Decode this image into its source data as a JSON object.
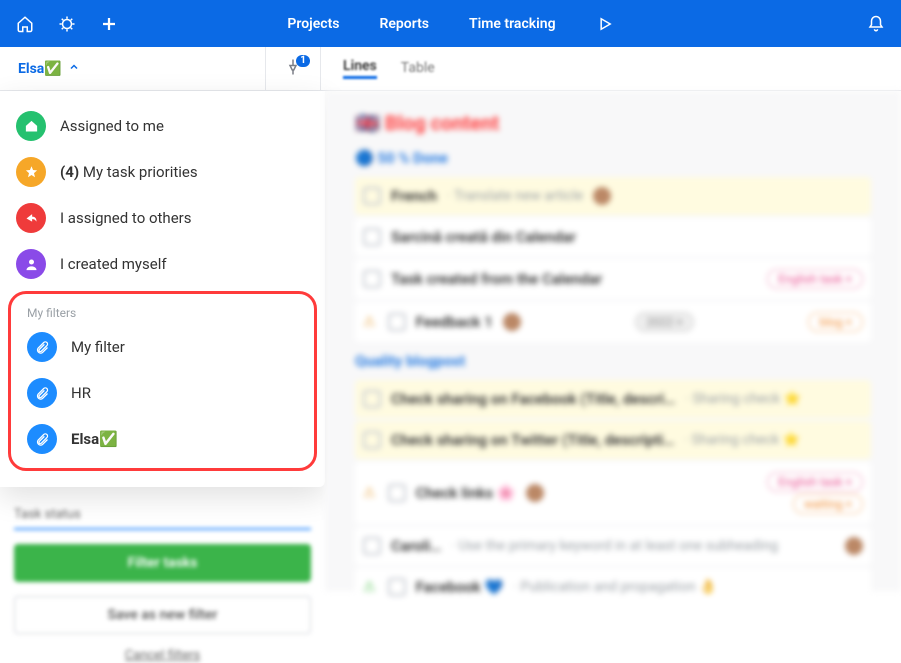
{
  "topbar": {
    "nav": {
      "projects": "Projects",
      "reports": "Reports",
      "time_tracking": "Time tracking"
    }
  },
  "subheader": {
    "filter_name": "Elsa✅",
    "pin_badge": "1",
    "tabs": {
      "lines": "Lines",
      "table": "Table"
    }
  },
  "sidebar": {
    "assigned_to_me": "Assigned to me",
    "priorities_count": "(4)",
    "priorities_label": "My task priorities",
    "assigned_to_others": "I assigned to others",
    "created_myself": "I created myself",
    "my_filters_header": "My filters",
    "filters": {
      "my_filter": "My filter",
      "hr": "HR",
      "elsa": "Elsa✅"
    },
    "task_status_label": "Task status",
    "filter_tasks_btn": "Filter tasks",
    "save_filter_btn": "Save as new filter",
    "cancel_filters": "Cancel filters"
  },
  "main": {
    "page_title": "Blog content",
    "section1": "🔵 50 % Done",
    "tasks1": {
      "french": "French",
      "french_meta": "Translate new article",
      "sarcina": "Sarcină creată din Calendar",
      "task_cal": "Task created from the Calendar",
      "feedback": "Feedback 1",
      "tag_english": "English task ×",
      "tag_year": "2022 ×",
      "tag_blog": "blog ×"
    },
    "section2": "Quality blogpost",
    "tasks2": {
      "fb_share": "Check sharing on Facebook (Title, descri…",
      "fb_share_meta": "Sharing check ⭐",
      "tw_share": "Check sharing on Twitter (Title, descripti…",
      "tw_share_meta": "Sharing check ⭐",
      "links": "Check links 🌸",
      "tag_english2": "English task ×",
      "tag_waiting": "waiting ×",
      "caroli": "Caroli…",
      "caroli_meta": "Use the primary keyword in at least one subheading",
      "facebook": "Facebook 💙",
      "facebook_meta": "Publication and propagation 👌"
    }
  }
}
